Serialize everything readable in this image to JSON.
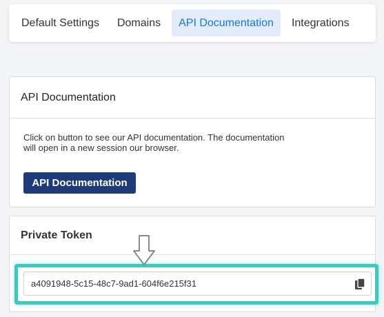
{
  "tabs": [
    {
      "label": "Default Settings"
    },
    {
      "label": "Domains"
    },
    {
      "label": "API Documentation"
    },
    {
      "label": "Integrations"
    }
  ],
  "active_tab": "API Documentation",
  "api_card": {
    "title": "API Documentation",
    "description": "Click on button to see our API documentation. The documentation will open in a new session our browser.",
    "button_label": "API Documentation"
  },
  "token_card": {
    "title": "Private Token",
    "token_value": "a4091948-5c15-48c7-9ad1-604f6e215f31"
  },
  "icons": {
    "copy": "copy-icon",
    "arrow": "down-arrow-icon"
  },
  "colors": {
    "accent": "#1a73e8",
    "active_tab_bg": "#e3ecfb",
    "primary_button": "#1e3a78",
    "highlight": "#3cc9bf"
  }
}
